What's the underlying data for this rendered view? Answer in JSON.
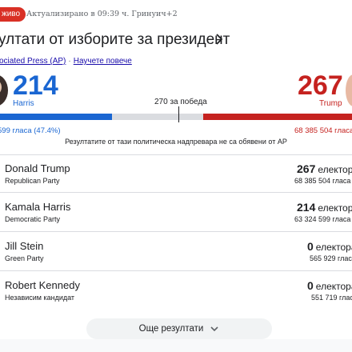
{
  "header": {
    "live_label": "живо",
    "updated": "Актуализирано в 09:39 ч. Гринуич+2"
  },
  "title": "ултати от изборите за президент",
  "source": {
    "name": "ociated Press (AP)",
    "separator": "·",
    "learn_more": "Научете повече"
  },
  "summary": {
    "harris": {
      "votes": "214",
      "name": "Harris",
      "popular": "599 гласа (47.4%)",
      "color": "#1a66d2"
    },
    "trump": {
      "votes": "267",
      "name": "Trump",
      "popular": "68 385 504 гласа",
      "color": "#c5221f"
    },
    "win_label": "270 за победа",
    "disclaimer": "Резултатите от тази политическа надпревара не са обявени от АР",
    "bar": {
      "total_electoral_votes": 538,
      "harris": 214,
      "trump": 267
    }
  },
  "candidates": [
    {
      "name": "Donald Trump",
      "party": "Republican Party",
      "ev": "267",
      "ev_label": "електорал",
      "popular": "68 385 504 гласа"
    },
    {
      "name": "Kamala Harris",
      "party": "Democratic Party",
      "ev": "214",
      "ev_label": "електорал",
      "popular": "63 324 599 гласа"
    },
    {
      "name": "Jill Stein",
      "party": "Green Party",
      "ev": "0",
      "ev_label": "електорал",
      "popular": "565 929 глас"
    },
    {
      "name": "Robert Kennedy",
      "party": "Независим кандидат",
      "ev": "0",
      "ev_label": "електорал",
      "popular": "551 719 глас"
    }
  ],
  "more_results": "Още резултати"
}
